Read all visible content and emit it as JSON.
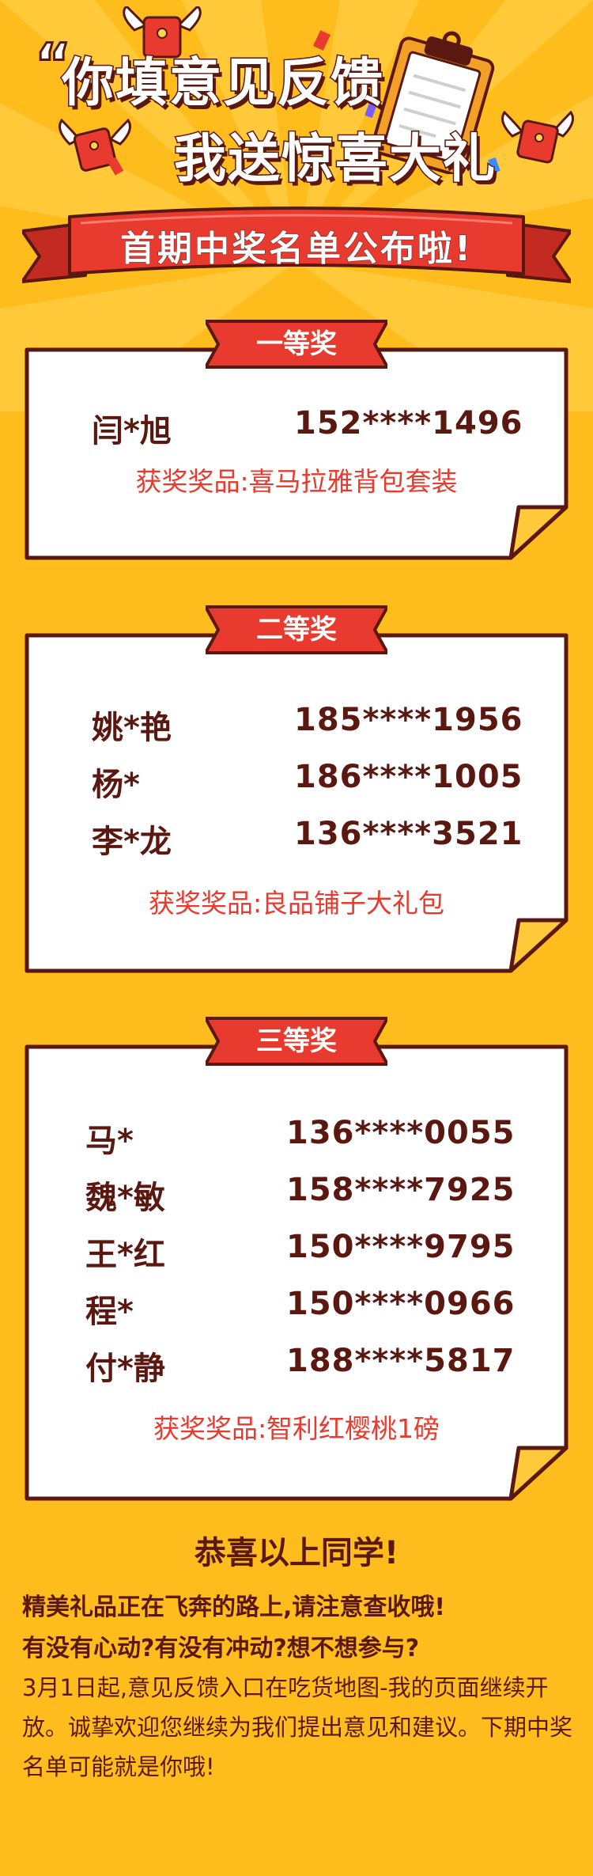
{
  "header": {
    "quote_mark": "“",
    "line1": "你填意见反馈",
    "line2": "我送惊喜大礼",
    "banner": "首期中奖名单公布啦!"
  },
  "prizes": [
    {
      "title": "一等奖",
      "winners": [
        {
          "name": "闫*旭",
          "phone": "152****1496"
        }
      ],
      "prize_label": "获奖奖品:喜马拉雅背包套装"
    },
    {
      "title": "二等奖",
      "winners": [
        {
          "name": "姚*艳",
          "phone": "185****1956"
        },
        {
          "name": "杨*",
          "phone": "186****1005"
        },
        {
          "name": "李*龙",
          "phone": "136****3521"
        }
      ],
      "prize_label": "获奖奖品:良品铺子大礼包"
    },
    {
      "title": "三等奖",
      "winners": [
        {
          "name": "马*",
          "phone": "136****0055"
        },
        {
          "name": "魏*敏",
          "phone": "158****7925"
        },
        {
          "name": "王*红",
          "phone": "150****9795"
        },
        {
          "name": "程*",
          "phone": "150****0966"
        },
        {
          "name": "付*静",
          "phone": "188****5817"
        }
      ],
      "prize_label": "获奖奖品:智利红樱桃1磅"
    }
  ],
  "footer": {
    "congrats": "恭喜以上同学!",
    "line1": "精美礼品正在飞奔的路上,请注意查收哦!",
    "line2": "有没有心动?有没有冲动?想不想参与?",
    "paragraph": "3月1日起,意见反馈入口在吃货地图-我的页面继续开放。诚挚欢迎您继续为我们提出意见和建议。下期中奖名单可能就是你哦!"
  },
  "colors": {
    "background": "#FFBD1D",
    "outline": "#5A1810",
    "ribbon_red": "#E83A2E",
    "prize_text": "#E83A2E"
  },
  "icons": [
    "red-envelope-icon",
    "clipboard-icon",
    "ribbon-banner",
    "page-curl-corner"
  ]
}
